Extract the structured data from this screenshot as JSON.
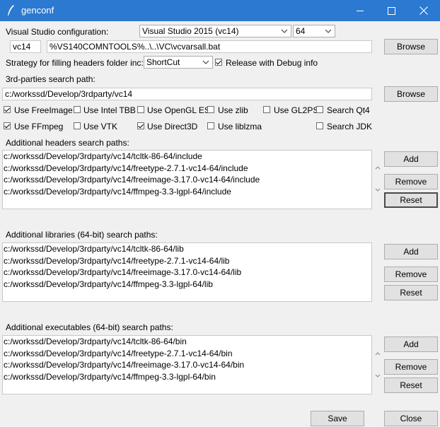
{
  "window": {
    "title": "genconf",
    "controls": {
      "minimize": "minimize-icon",
      "maximize": "maximize-icon",
      "close": "close-icon"
    },
    "accent_color": "#2b79d0"
  },
  "vs_config": {
    "label": "Visual Studio configuration:",
    "version_selected": "Visual Studio 2015 (vc14)",
    "arch_selected": "64",
    "short_name": "vc14",
    "vcvars_path": "%VS140COMNTOOLS%..\\..\\VC\\vcvarsall.bat",
    "browse_label": "Browse"
  },
  "strategy": {
    "label": "Strategy for filling headers folder inc:",
    "selected": "ShortCut",
    "release_debug_label": "Release with Debug info",
    "release_debug_checked": true
  },
  "third_party": {
    "label": "3rd-parties search path:",
    "path": "c:/workssd/Develop/3rdparty/vc14",
    "browse_label": "Browse"
  },
  "options": [
    {
      "label": "Use FreeImage",
      "checked": true
    },
    {
      "label": "Use Intel TBB",
      "checked": false
    },
    {
      "label": "Use OpenGL ES",
      "checked": false
    },
    {
      "label": "Use zlib",
      "checked": false
    },
    {
      "label": "Use GL2PS",
      "checked": false
    },
    {
      "label": "Search Qt4",
      "checked": false
    },
    {
      "label": "Use FFmpeg",
      "checked": true
    },
    {
      "label": "Use VTK",
      "checked": false
    },
    {
      "label": "Use Direct3D",
      "checked": true
    },
    {
      "label": "Use liblzma",
      "checked": false
    },
    {
      "label": "Search JDK",
      "checked": false
    }
  ],
  "headers": {
    "label": "Additional headers search paths:",
    "items": [
      "c:/workssd/Develop/3rdparty/vc14/tcltk-86-64/include",
      "c:/workssd/Develop/3rdparty/vc14/freetype-2.7.1-vc14-64/include",
      "c:/workssd/Develop/3rdparty/vc14/freeimage-3.17.0-vc14-64/include",
      "c:/workssd/Develop/3rdparty/vc14/ffmpeg-3.3-lgpl-64/include"
    ]
  },
  "libraries": {
    "label": "Additional libraries (64-bit) search paths:",
    "items": [
      "c:/workssd/Develop/3rdparty/vc14/tcltk-86-64/lib",
      "c:/workssd/Develop/3rdparty/vc14/freetype-2.7.1-vc14-64/lib",
      "c:/workssd/Develop/3rdparty/vc14/freeimage-3.17.0-vc14-64/lib",
      "c:/workssd/Develop/3rdparty/vc14/ffmpeg-3.3-lgpl-64/lib"
    ]
  },
  "executables": {
    "label": "Additional executables (64-bit) search paths:",
    "items": [
      "c:/workssd/Develop/3rdparty/vc14/tcltk-86-64/bin",
      "c:/workssd/Develop/3rdparty/vc14/freetype-2.7.1-vc14-64/bin",
      "c:/workssd/Develop/3rdparty/vc14/freeimage-3.17.0-vc14-64/bin",
      "c:/workssd/Develop/3rdparty/vc14/ffmpeg-3.3-lgpl-64/bin"
    ]
  },
  "buttons": {
    "add": "Add",
    "remove": "Remove",
    "reset": "Reset",
    "save": "Save",
    "close": "Close"
  }
}
